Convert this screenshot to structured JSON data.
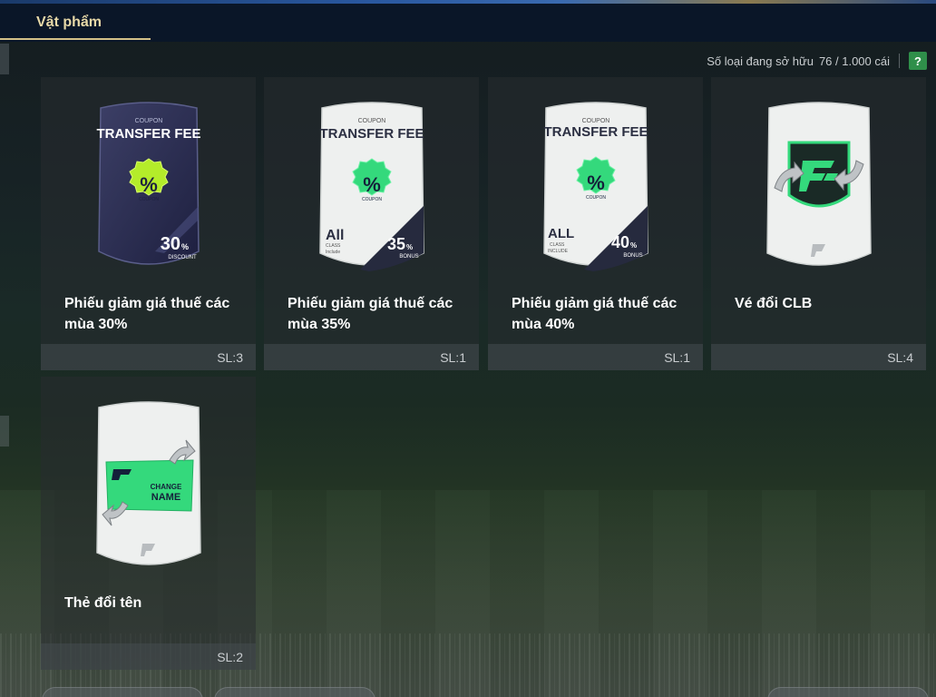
{
  "tab": {
    "label": "Vật phẩm"
  },
  "owned": {
    "label": "Số loại đang sở hữu",
    "value": "76 / 1.000 cái",
    "help": "?"
  },
  "colors": {
    "accent": "#d4c088",
    "header": "#0a1628",
    "help": "#2f8f4a",
    "coupon_green": "#34d97c",
    "lime": "#b4ec2a"
  },
  "items": [
    {
      "name": "Phiếu giảm giá thuế các mùa 30%",
      "qty": "SL:3",
      "art": {
        "kind": "coupon-dark",
        "top": "COUPON",
        "title": "TRANSFER FEE",
        "badge_sub": "COUPON",
        "value": "30",
        "value_unit": "%",
        "value_sub": "DISCOUNT"
      }
    },
    {
      "name": "Phiếu giảm giá thuế các mùa 35%",
      "qty": "SL:1",
      "art": {
        "kind": "coupon-white",
        "top": "COUPON",
        "title": "TRANSFER FEE",
        "badge_sub": "COUPON",
        "left_big": "All",
        "left_sub1": "CLASS",
        "left_sub2": "Include",
        "value": "35",
        "value_unit": "%",
        "value_sub": "BONUS"
      }
    },
    {
      "name": "Phiếu giảm giá thuế các mùa 40%",
      "qty": "SL:1",
      "art": {
        "kind": "coupon-white",
        "top": "COUPON",
        "title": "TRANSFER FEE",
        "badge_sub": "COUPON",
        "left_big": "ALL",
        "left_sub1": "CLASS",
        "left_sub2": "INCLUDE",
        "value": "40",
        "value_unit": "%",
        "value_sub": "BONUS"
      }
    },
    {
      "name": "Vé đổi CLB",
      "qty": "SL:4",
      "art": {
        "kind": "club-ticket"
      }
    },
    {
      "name": "Thẻ đổi tên",
      "qty": "SL:2",
      "art": {
        "kind": "change-name",
        "line1": "CHANGE",
        "line2": "NAME"
      }
    }
  ]
}
